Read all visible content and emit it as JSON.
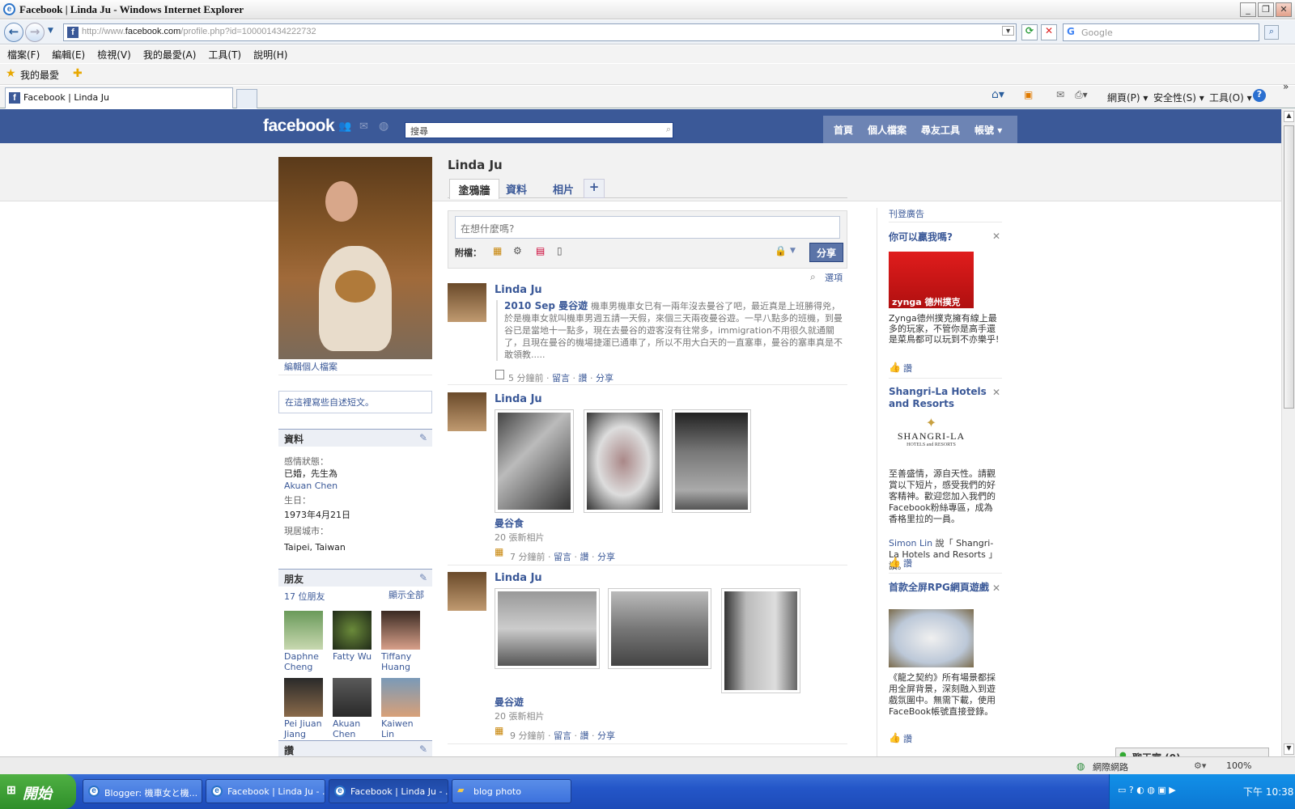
{
  "window": {
    "title": "Facebook | Linda Ju - Windows Internet Explorer",
    "controls": [
      "_",
      "❐",
      "✕"
    ]
  },
  "address": {
    "prefix": "http://www.",
    "domain": "facebook.com",
    "path": "/profile.php?id=100001434222732"
  },
  "search_engine": {
    "placeholder": "Google"
  },
  "menu": [
    "檔案(F)",
    "編輯(E)",
    "檢視(V)",
    "我的最愛(A)",
    "工具(T)",
    "說明(H)"
  ],
  "favorites": {
    "label": "我的最愛"
  },
  "tab": {
    "label": "Facebook | Linda Ju"
  },
  "toolbar_right": [
    "網頁(P) ▾",
    "安全性(S) ▾",
    "工具(O) ▾"
  ],
  "fb": {
    "logo": "facebook",
    "search_placeholder": "搜尋",
    "nav": [
      "首頁",
      "個人檔案",
      "尋友工具",
      "帳號 ▾"
    ]
  },
  "profile": {
    "name": "Linda Ju",
    "edit_profile": "編輯個人檔案",
    "bio_prompt": "在這裡寫些自述短文。",
    "info_header": "資料",
    "info": [
      {
        "label": "感情狀態：",
        "value": "已婚，先生為",
        "link": "Akuan Chen"
      },
      {
        "label": "生日：",
        "value": "1973年4月21日"
      },
      {
        "label": "現居城市：",
        "value": "Taipei, Taiwan"
      }
    ],
    "friends_header": "朋友",
    "friends_count": "17 位朋友",
    "friends_all": "顯示全部",
    "friends": [
      {
        "name1": "Daphne",
        "name2": "Cheng"
      },
      {
        "name1": "Fatty Wu",
        "name2": ""
      },
      {
        "name1": "Tiffany",
        "name2": "Huang"
      },
      {
        "name1": "Pei Jiuan",
        "name2": "Jiang"
      },
      {
        "name1": "Akuan",
        "name2": "Chen"
      },
      {
        "name1": "Kaiwen",
        "name2": "Lin"
      }
    ],
    "likes_header": "讚"
  },
  "tabs": [
    "塗鴉牆",
    "資料",
    "相片",
    "+"
  ],
  "composer": {
    "placeholder": "在想什麼嗎?",
    "attach_label": "附檔：",
    "share": "分享"
  },
  "options": "選項",
  "feed": [
    {
      "name": "Linda Ju",
      "note_title": "2010 Sep 曼谷遊",
      "note_text": "機車男機車女已有一兩年沒去曼谷了吧，最近真是上班勝得兇，於是機車女就叫機車男週五請一天假，來個三天兩夜曼谷遊。一早八點多的班機，到曼谷已是當地十一點多，現在去曼谷的遊客沒有往常多，immigration不用很久就通關了，且現在曼谷的機場捷運已通車了，所以不用大白天的一直塞車，曼谷的塞車真是不敢領教.....",
      "time": "5 分鐘前",
      "actions": [
        "留言",
        "讚",
        "分享"
      ]
    },
    {
      "name": "Linda Ju",
      "album": "曼谷食",
      "count": "20 張新相片",
      "time": "7 分鐘前",
      "actions": [
        "留言",
        "讚",
        "分享"
      ]
    },
    {
      "name": "Linda Ju",
      "album": "曼谷遊",
      "count": "20 張新相片",
      "time": "9 分鐘前",
      "actions": [
        "留言",
        "讚",
        "分享"
      ]
    }
  ],
  "ads": {
    "header": "刊登廣告",
    "items": [
      {
        "title": "你可以贏我嗎?",
        "image_text": "zynga 德州撲克",
        "body": "Zynga德州撲克擁有線上最多的玩家，不管你是高手還是菜鳥都可以玩到不亦樂乎!",
        "like": "讚"
      },
      {
        "title": "Shangri-La Hotels and Resorts",
        "image_text": "SHANGRI-LA",
        "image_sub": "HOTELS and RESORTS",
        "body": "至善盛情，源自天性。請觀賞以下短片，感受我們的好客精神。歡迎您加入我們的Facebook粉絲專區，成為香格里拉的一員。",
        "social_name": "Simon Lin",
        "social_text": "說「 Shangri-La Hotels and Resorts 」讚。",
        "like": "讚"
      },
      {
        "title": "首款全屏RPG網頁遊戲",
        "body": "《龍之契約》所有場景都採用全屏背景，深刻融入到遊戲氛圍中。無需下載，使用FaceBook帳號直接登錄。",
        "like": "讚"
      }
    ]
  },
  "chat": "聊天室 (0)",
  "status": {
    "zone": "網際網路",
    "zoom": "100%"
  },
  "taskbar": {
    "start": "開始",
    "tasks": [
      "Blogger: 機車女と機...",
      "Facebook | Linda Ju - ...",
      "Facebook | Linda Ju - ...",
      "blog photo"
    ],
    "clock": "下午 10:38"
  },
  "colors": {
    "fb_blue": "#3b5998",
    "link": "#3b5998",
    "taskbar": "#2456c8"
  }
}
